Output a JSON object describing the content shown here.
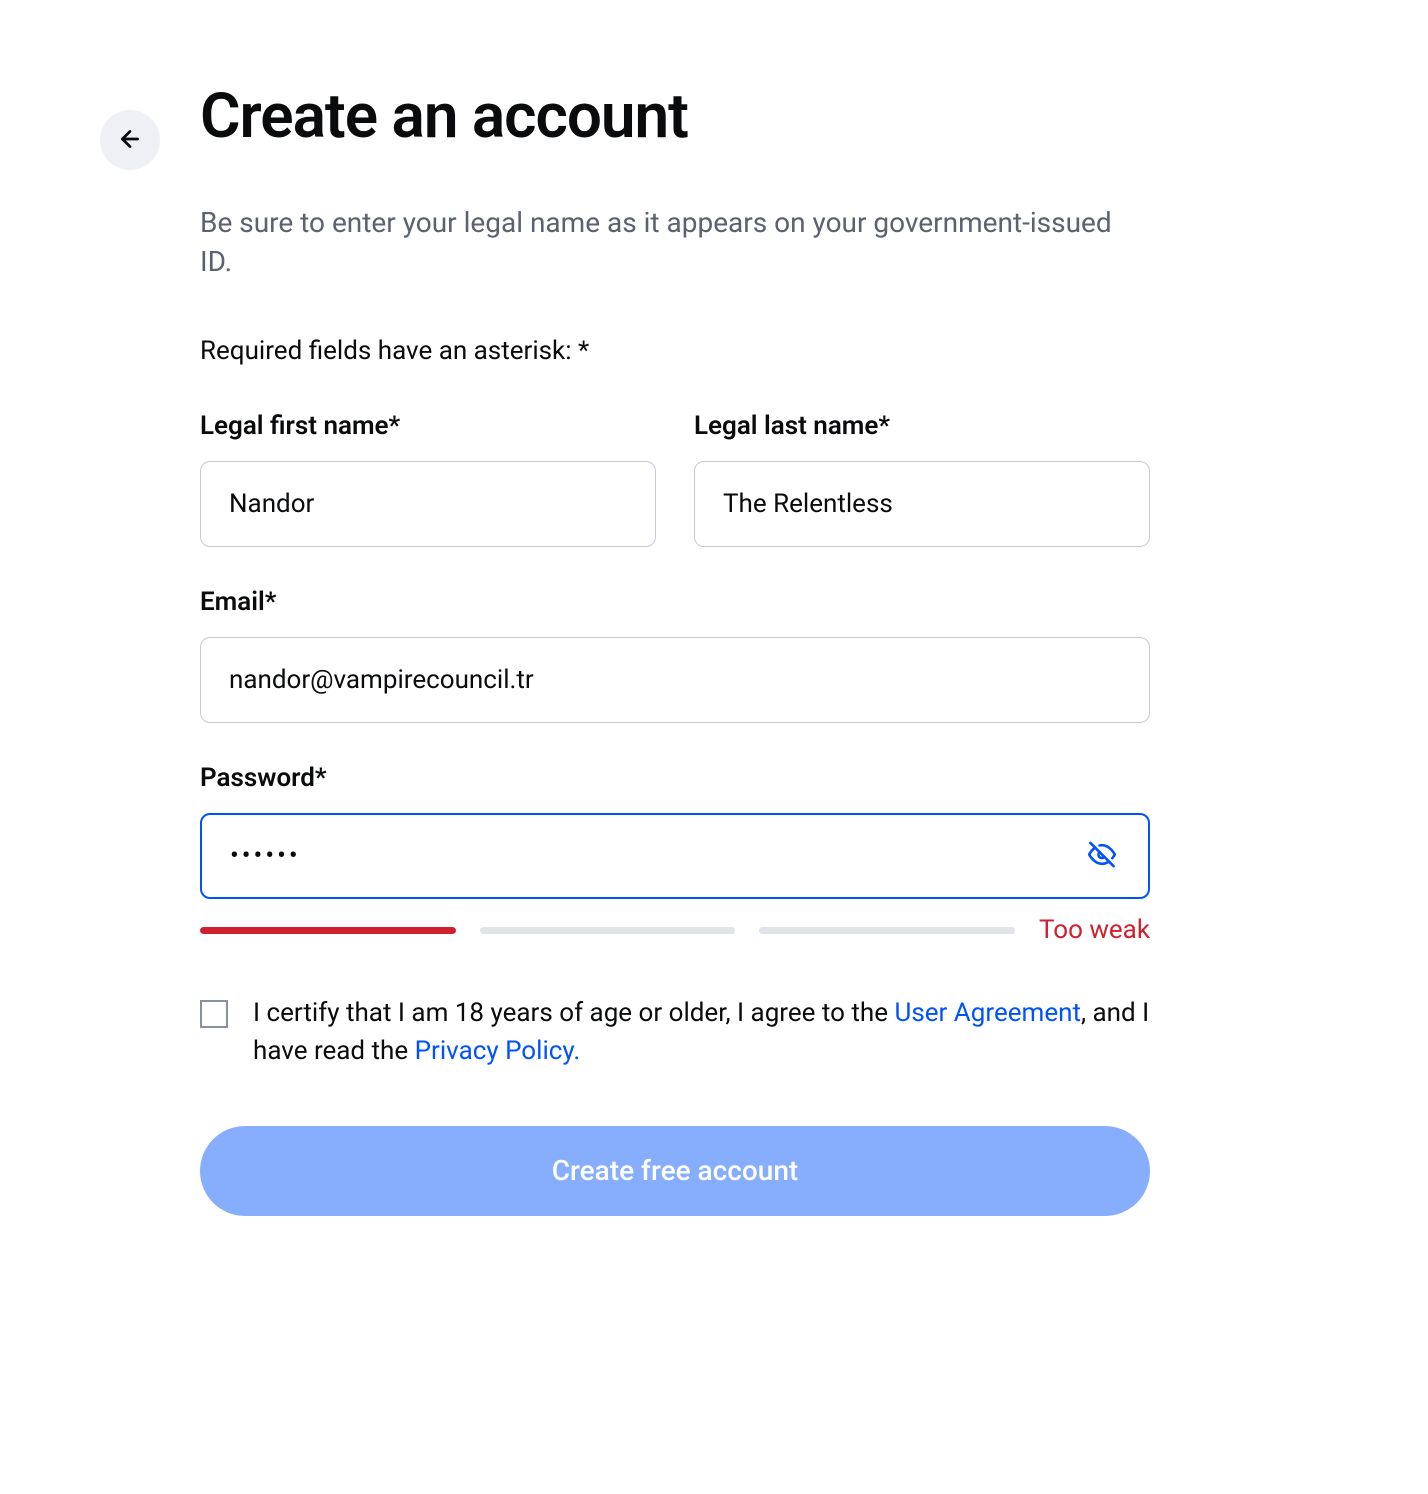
{
  "header": {
    "title": "Create an account",
    "subtitle": "Be sure to enter your legal name as it appears on your government-issued ID.",
    "required_note": "Required fields have an asterisk: *"
  },
  "fields": {
    "first_name": {
      "label": "Legal first name*",
      "value": "Nandor"
    },
    "last_name": {
      "label": "Legal last name*",
      "value": "The Relentless"
    },
    "email": {
      "label": "Email*",
      "value": "nandor@vampirecouncil.tr"
    },
    "password": {
      "label": "Password*",
      "value": "••••••",
      "strength_text": "Too weak"
    }
  },
  "consent": {
    "text_part1": "I certify that I am 18 years of age or older, I agree to the ",
    "link1": "User Agreement",
    "text_part2": ", and I have read the ",
    "link2": "Privacy Policy."
  },
  "submit": {
    "label": "Create free account"
  },
  "icons": {
    "back": "arrow-left-icon",
    "eye_off": "eye-off-icon"
  },
  "colors": {
    "primary": "#0052ff",
    "danger": "#cf202f",
    "text": "#0a0b0d",
    "muted": "#5b616e",
    "border": "#c6cad2",
    "disabled_button": "#87aefc"
  }
}
